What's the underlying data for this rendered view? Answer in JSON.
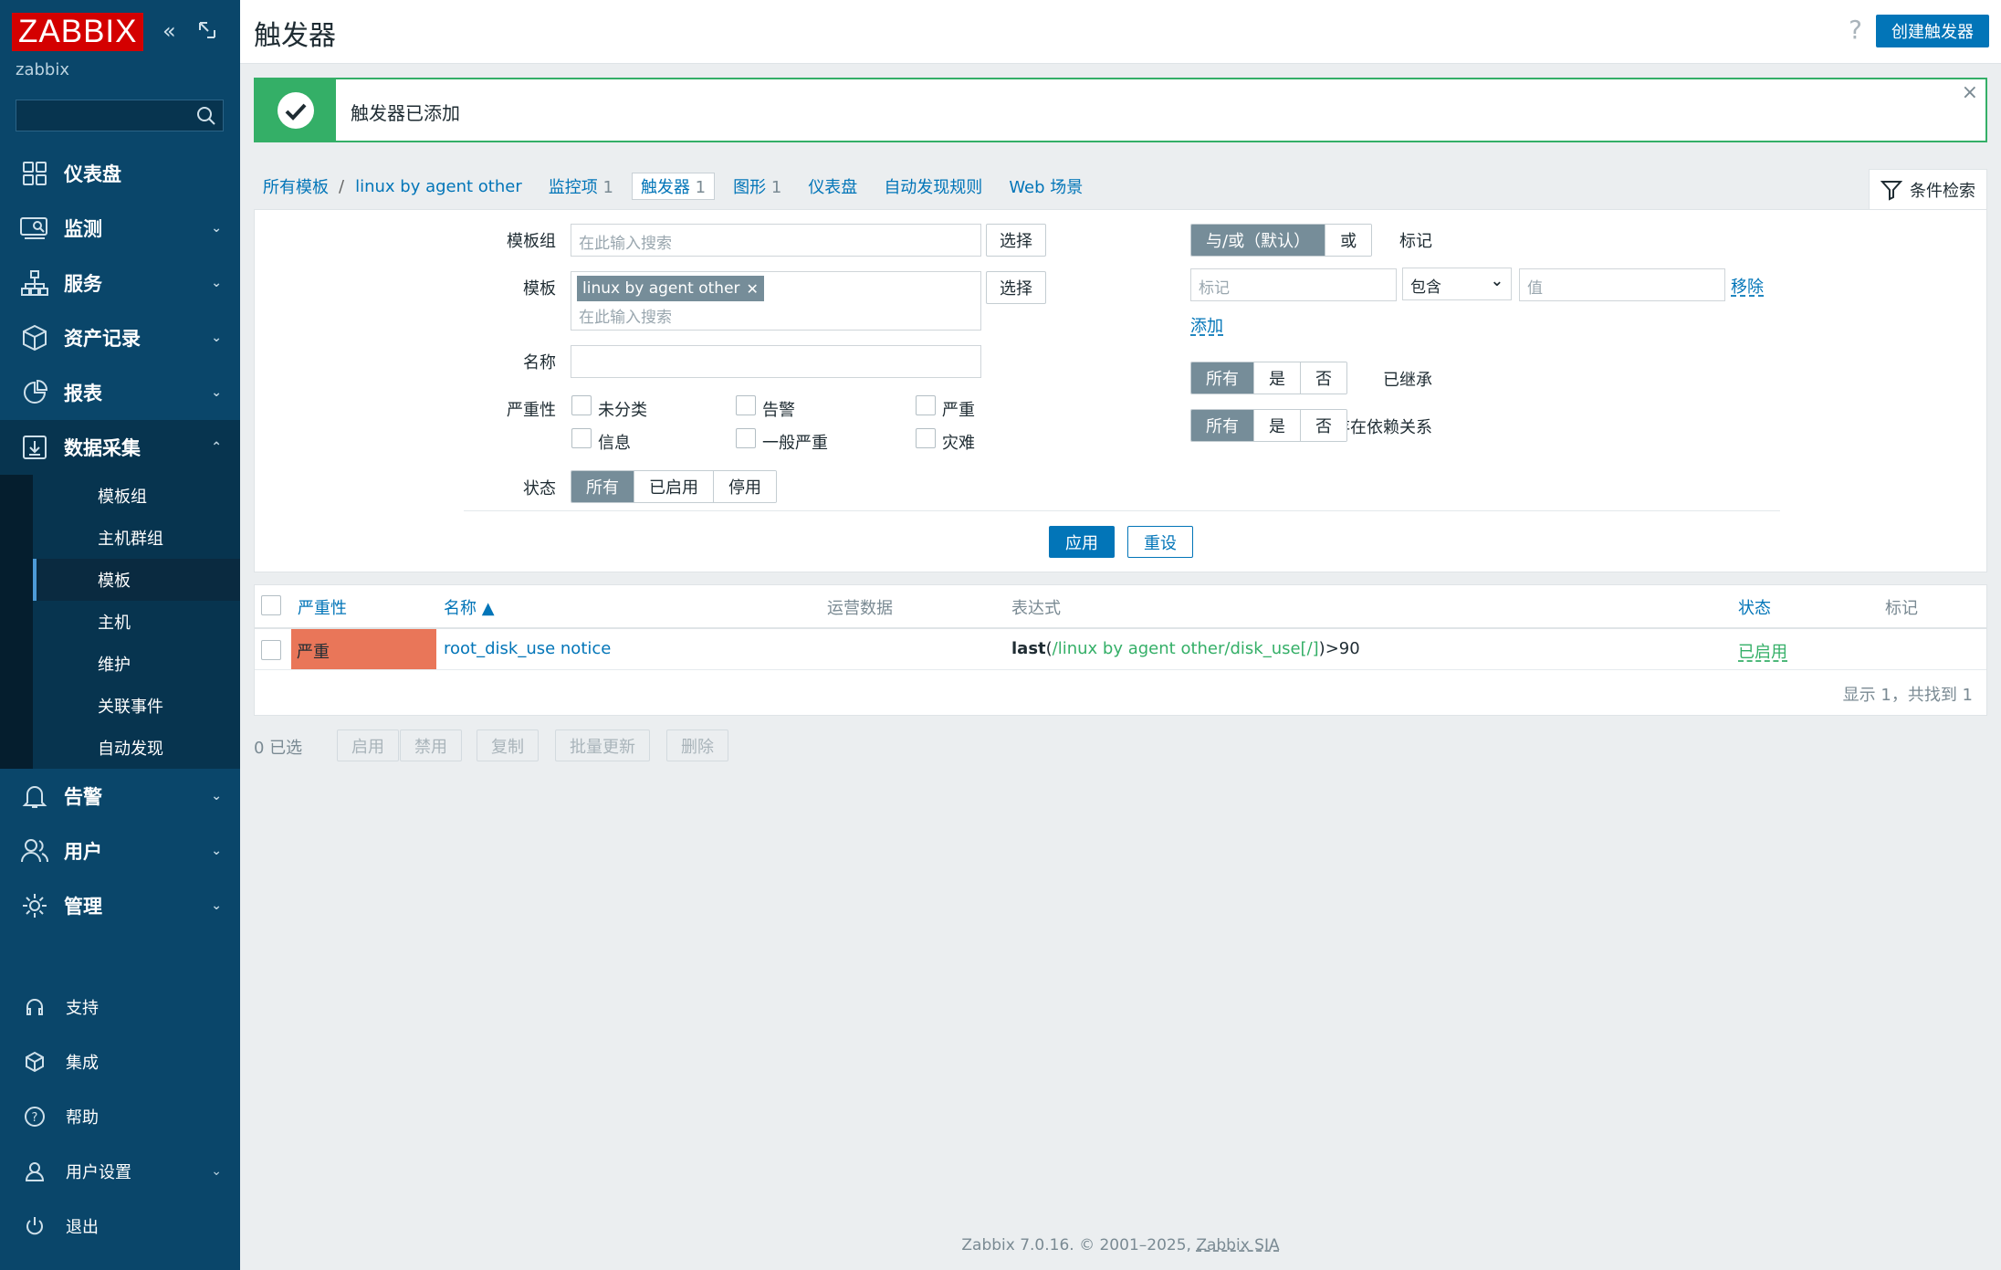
{
  "logo": "ZABBIX",
  "server_name": "zabbix",
  "nav": {
    "dashboard": "仪表盘",
    "monitoring": "监测",
    "services": "服务",
    "inventory": "资产记录",
    "reports": "报表",
    "data_collection": "数据采集",
    "sub": [
      "模板组",
      "主机群组",
      "模板",
      "主机",
      "维护",
      "关联事件",
      "自动发现"
    ],
    "alerts": "告警",
    "users": "用户",
    "administration": "管理"
  },
  "bottom_nav": [
    "支持",
    "集成",
    "帮助",
    "用户设置",
    "退出"
  ],
  "header": {
    "title": "触发器",
    "help": "?",
    "create": "创建触发器"
  },
  "message": "触发器已添加",
  "tabs": {
    "all_templates": "所有模板",
    "sep": "/",
    "template": "linux by agent other",
    "items": "监控项",
    "items_count": "1",
    "triggers": "触发器",
    "triggers_count": "1",
    "graphs": "图形",
    "graphs_count": "1",
    "dashboards": "仪表盘",
    "discovery": "自动发现规则",
    "web": "Web 场景",
    "filter": "条件检索"
  },
  "filter": {
    "template_group_label": "模板组",
    "template_label": "模板",
    "name_label": "名称",
    "severity_label": "严重性",
    "status_label": "状态",
    "search_placeholder": "在此输入搜索",
    "select": "选择",
    "template_tag": "linux by agent other",
    "severities": [
      "未分类",
      "告警",
      "严重",
      "信息",
      "一般严重",
      "灾难"
    ],
    "status_options": [
      "所有",
      "已启用",
      "停用"
    ],
    "tags_label": "标记",
    "tags_mode": [
      "与/或（默认）",
      "或"
    ],
    "tag_placeholder": "标记",
    "tag_operator": "包含",
    "value_placeholder": "值",
    "remove": "移除",
    "add": "添加",
    "inherited_label": "已继承",
    "dependencies_label": "存在依赖关系",
    "tri_options": [
      "所有",
      "是",
      "否"
    ],
    "apply": "应用",
    "reset": "重设"
  },
  "table": {
    "headers": {
      "severity": "严重性",
      "name": "名称 ▲",
      "opdata": "运营数据",
      "expression": "表达式",
      "status": "状态",
      "tags": "标记"
    },
    "rows": [
      {
        "severity": "严重",
        "name": "root_disk_use notice",
        "expr_fn": "last",
        "expr_open": "(",
        "expr_item": "/linux by agent other/disk_use[/]",
        "expr_close": ")>90",
        "status": "已启用"
      }
    ],
    "paging": "显示 1，共找到 1"
  },
  "actions": {
    "selected": "0 已选",
    "buttons": [
      "启用",
      "禁用",
      "复制",
      "批量更新",
      "删除"
    ]
  },
  "footer": {
    "text": "Zabbix 7.0.16. © 2001–2025, ",
    "company": "Zabbix SIA"
  },
  "colors": {
    "sidebar": "#0a466a",
    "accent": "#0275b8",
    "success": "#34af67",
    "high_severity": "#e97659",
    "logo": "#d40000"
  }
}
